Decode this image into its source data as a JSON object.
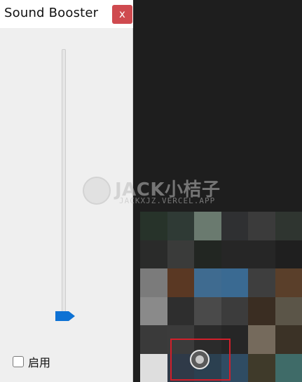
{
  "window": {
    "title": "Sound Booster",
    "close_symbol": "x"
  },
  "slider": {
    "level_fraction": 0.02,
    "orientation": "vertical"
  },
  "checkbox": {
    "label": "启用",
    "checked": false
  },
  "watermark": {
    "title": "JACK小桔子",
    "subtitle": "JACKXJZ.VERCEL.APP"
  },
  "mosaic": {
    "colors": [
      "#27332a",
      "#2f3a35",
      "#6a7a6f",
      "#2f3032",
      "#3b3b3b",
      "#2f3530",
      "#2a2b2a",
      "#3a3b3a",
      "#222622",
      "#262626",
      "#262626",
      "#1f1f1f",
      "#7b7b7b",
      "#5a3823",
      "#3f6b90",
      "#3a6a92",
      "#3e3e3e",
      "#5a3f2a",
      "#8a8a8a",
      "#2e2e2e",
      "#4a4a4a",
      "#3c3c3c",
      "#3a2d22",
      "#5b5548",
      "#3a3a3a",
      "#3b3b3b",
      "#2b2b2b",
      "#262626",
      "#756a5c",
      "#3b3226",
      "#dedede",
      "#2f3a48",
      "#2b4050",
      "#2f4c63",
      "#3f3a2a",
      "#3f6b68"
    ]
  },
  "colors": {
    "accent_blue": "#0e72d4",
    "close_red": "#cf4a4f",
    "highlight_red": "#d21f2a"
  },
  "icons": [
    "close-icon",
    "slider-thumb-icon",
    "checkbox-icon",
    "record-dot-icon"
  ]
}
